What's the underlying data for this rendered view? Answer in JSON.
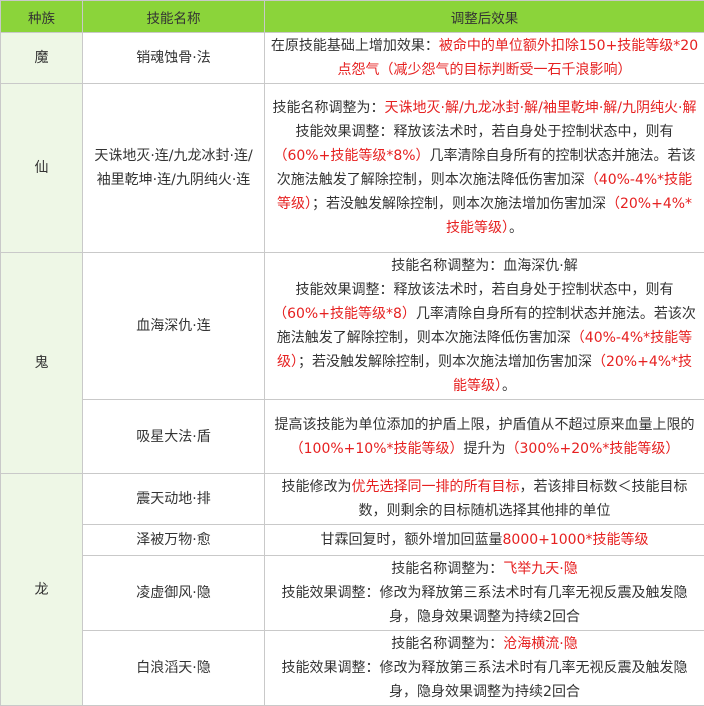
{
  "headers": [
    "种族",
    "技能名称",
    "调整后效果"
  ],
  "rows": [
    {
      "tribe": "魔",
      "skill": "销魂蚀骨·法",
      "effect": [
        {
          "t": "在原技能基础上增加效果：",
          "red": false
        },
        {
          "t": "被命中的单位额外扣除150+技能等级*20点怨气（减少怨气的目标判断受一石千浪影响）",
          "red": true
        }
      ]
    },
    {
      "tribe": "仙",
      "skill": "天诛地灭·连/九龙冰封·连/袖里乾坤·连/九阴纯火·连",
      "effect": [
        {
          "t": "技能名称调整为：",
          "red": false
        },
        {
          "t": "天诛地灭·解/九龙冰封·解/袖里乾坤·解/九阴纯火·解",
          "red": true
        },
        {
          "t": "技能效果调整：释放该法术时，若自身处于控制状态中，则有",
          "red": false
        },
        {
          "t": "（60%+技能等级*8%）",
          "red": true
        },
        {
          "t": "几率清除自身所有的控制状态并施法。若该次施法触发了解除控制，则本次施法降低伤害加深",
          "red": false
        },
        {
          "t": "（40%-4%*技能等级）",
          "red": true
        },
        {
          "t": "；若没触发解除控制，则本次施法增加伤害加深",
          "red": false
        },
        {
          "t": "（20%+4%*技能等级）",
          "red": true
        },
        {
          "t": "。",
          "red": false
        }
      ]
    },
    {
      "tribe": "鬼",
      "skill": "血海深仇·连",
      "effect": [
        {
          "t": "技能名称调整为：血海深仇·解",
          "red": false
        },
        {
          "t": "技能效果调整：释放该法术时，若自身处于控制状态中，则有",
          "red": false
        },
        {
          "t": "（60%+技能等级*8）",
          "red": true
        },
        {
          "t": "几率清除自身所有的控制状态并施法。若该次施法触发了解除控制，则本次施法降低伤害加深",
          "red": false
        },
        {
          "t": "（40%-4%*技能等级）",
          "red": true
        },
        {
          "t": "；若没触发解除控制，则本次施法增加伤害加深",
          "red": false
        },
        {
          "t": "（20%+4%*技能等级）",
          "red": true
        },
        {
          "t": "。",
          "red": false
        }
      ]
    },
    {
      "tribe": "",
      "skill": "吸星大法·盾",
      "effect": [
        {
          "t": "提高该技能为单位添加的护盾上限，护盾值从不超过原来血量上限的",
          "red": false
        },
        {
          "t": "（100%+10%*技能等级）",
          "red": true
        },
        {
          "t": "提升为",
          "red": false
        },
        {
          "t": "（300%+20%*技能等级）",
          "red": true
        }
      ]
    },
    {
      "tribe": "龙",
      "skill": "震天动地·排",
      "effect": [
        {
          "t": "技能修改为",
          "red": false
        },
        {
          "t": "优先选择同一排的所有目标",
          "red": true
        },
        {
          "t": "，若该排目标数＜技能目标数，则剩余的目标随机选择其他排的单位",
          "red": false
        }
      ]
    },
    {
      "tribe": "",
      "skill": "泽被万物·愈",
      "effect": [
        {
          "t": "甘霖回复时，额外增加回蓝量",
          "red": false
        },
        {
          "t": "8000+1000*技能等级",
          "red": true
        }
      ]
    },
    {
      "tribe": "",
      "skill": "凌虚御风·隐",
      "effect": [
        {
          "t": "技能名称调整为：",
          "red": false
        },
        {
          "t": "飞举九天·隐",
          "red": true
        },
        {
          "t": "技能效果调整：修改为释放第三系法术时有几率无视反震及触发隐身，隐身效果调整为持续2回合",
          "red": false
        }
      ]
    },
    {
      "tribe": "",
      "skill": "白浪滔天·隐",
      "effect": [
        {
          "t": "技能名称调整为：",
          "red": false
        },
        {
          "t": "沧海横流·隐",
          "red": true
        },
        {
          "t": "技能效果调整：修改为释放第三系法术时有几率无视反震及触发隐身，隐身效果调整为持续2回合",
          "red": false
        }
      ]
    }
  ]
}
